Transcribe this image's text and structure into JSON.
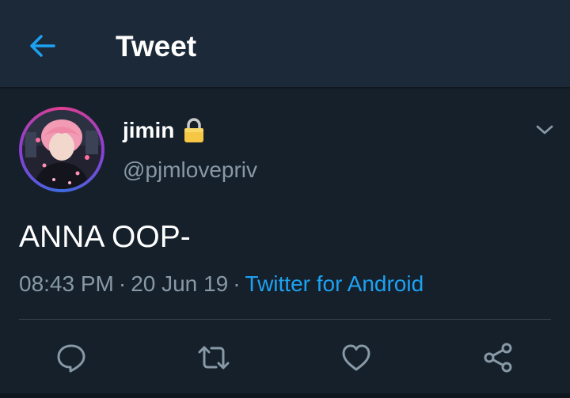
{
  "header": {
    "title": "Tweet",
    "back_icon": "arrow-left-icon",
    "accent_color": "#1da1f2"
  },
  "tweet": {
    "author": {
      "name": "jimin",
      "handle": "@pjmlovepriv",
      "protected_icon": "lock-icon"
    },
    "text": "ANNA OOP-",
    "time": "08:43 PM",
    "date": "20 Jun 19",
    "separator": "·",
    "source": "Twitter for Android",
    "menu_icon": "chevron-down-icon"
  },
  "actions": [
    {
      "name": "reply",
      "icon": "speech-bubble-icon"
    },
    {
      "name": "retweet",
      "icon": "retweet-icon"
    },
    {
      "name": "like",
      "icon": "heart-icon"
    },
    {
      "name": "share",
      "icon": "share-icon"
    }
  ],
  "colors": {
    "background": "#15202b",
    "header_background": "#1c2938",
    "secondary_text": "#8899a6",
    "link": "#1da1f2"
  }
}
